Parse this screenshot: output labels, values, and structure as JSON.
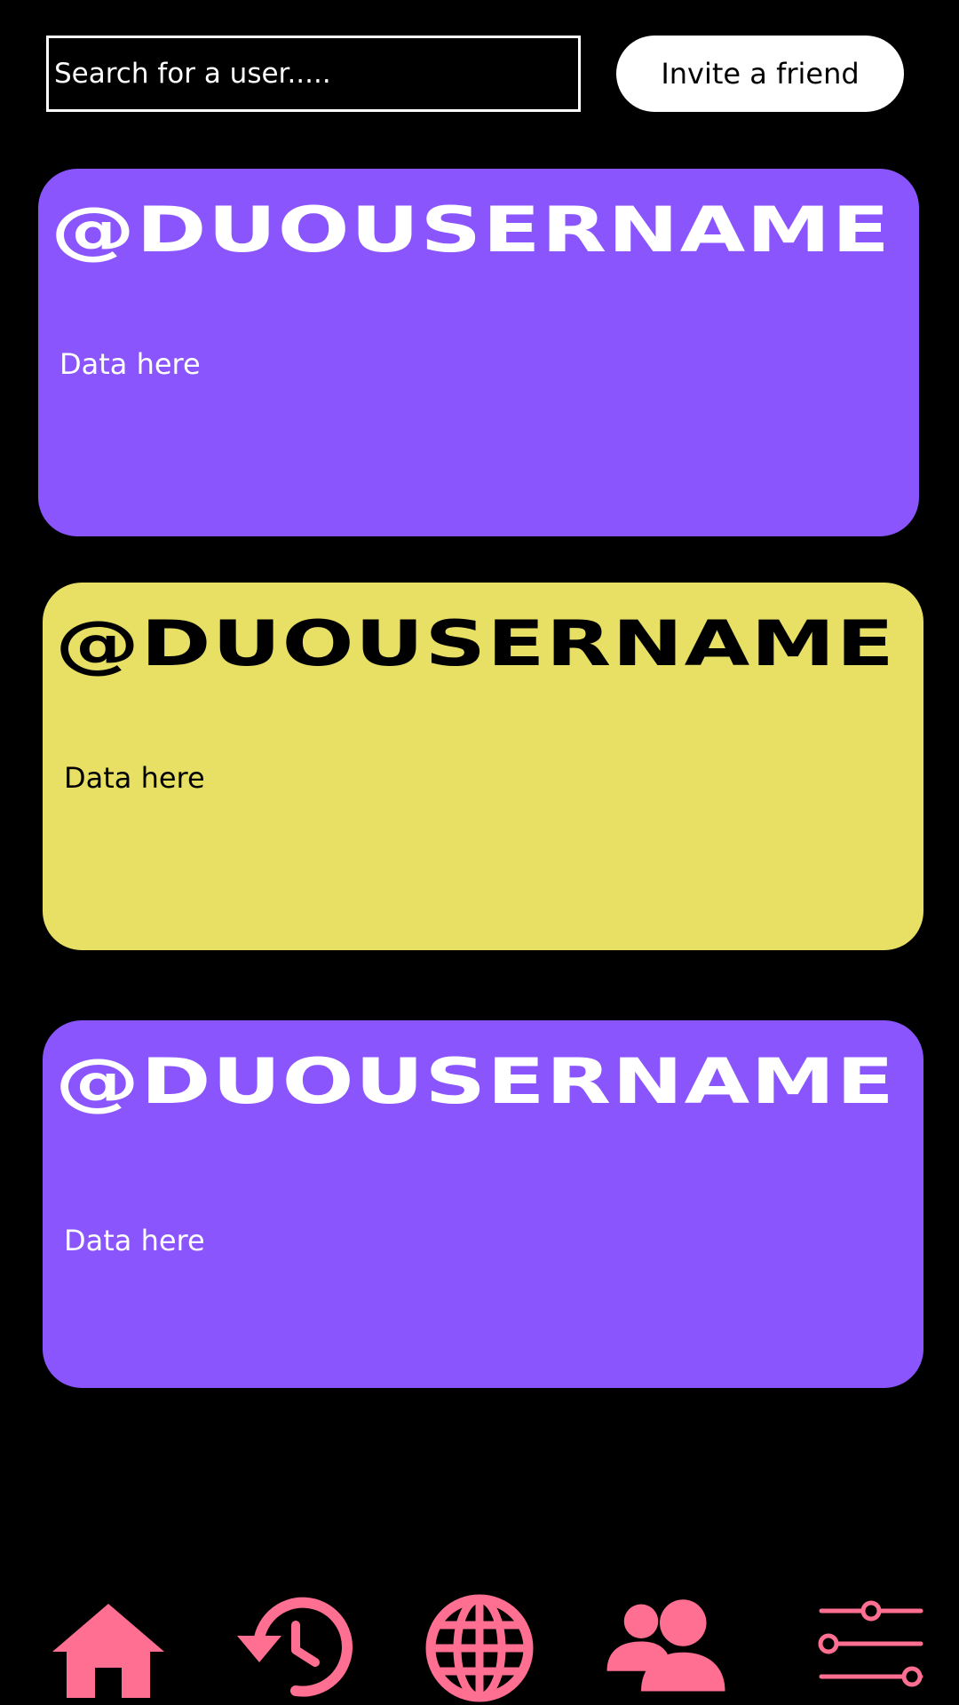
{
  "search": {
    "placeholder": "Search for a user....."
  },
  "invite": {
    "label": "Invite a friend"
  },
  "colors": {
    "background": "#000000",
    "purple_card": "#8a55fd",
    "yellow_card": "#e8e064",
    "accent_pink": "#ff6f91",
    "white": "#ffffff"
  },
  "cards": [
    {
      "username": "@DUOUSERNAME",
      "data": "Data here",
      "color": "purple",
      "text_color": "#ffffff"
    },
    {
      "username": "@DUOUSERNAME",
      "data": "Data here",
      "color": "yellow",
      "text_color": "#000000"
    },
    {
      "username": "@DUOUSERNAME",
      "data": "Data here",
      "color": "purple",
      "text_color": "#ffffff"
    }
  ],
  "nav": {
    "items": [
      {
        "icon": "home-icon"
      },
      {
        "icon": "history-icon"
      },
      {
        "icon": "globe-icon"
      },
      {
        "icon": "friends-icon"
      },
      {
        "icon": "settings-sliders-icon"
      }
    ]
  }
}
